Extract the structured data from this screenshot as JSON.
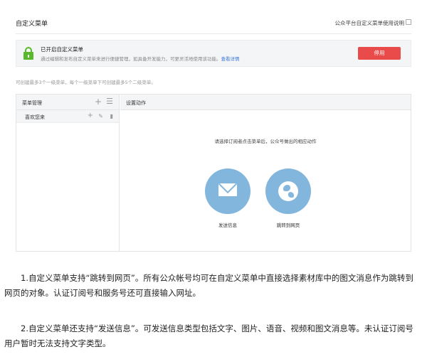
{
  "header": {
    "title": "自定义菜单",
    "help_link": "公众平台自定义菜单使用说明"
  },
  "notice": {
    "title": "已开启自定义菜单",
    "description": "通过编辑和发布自定义菜单来进行便捷管理，如具备开发能力，可更灵活地使用该功能。",
    "link": "查看详情",
    "stop_button": "停用"
  },
  "limit_note": "可创建最多3个一级菜单，每个一级菜单下可创建最多5个二级菜单。",
  "menu_panel": {
    "title": "菜单管理",
    "items": [
      {
        "label": "喜欢您来"
      }
    ]
  },
  "action_panel": {
    "title": "设置动作",
    "prompt": "请选择订阅者点击菜单后，公众号做出的相应动作",
    "options": [
      {
        "label": "发送信息",
        "icon": "mail-icon"
      },
      {
        "label": "跳转到网页",
        "icon": "globe-icon"
      }
    ]
  },
  "colors": {
    "accent_green": "#59b82b",
    "stop_red": "#e94a4a",
    "action_blue": "#83b6dd",
    "link_blue": "#3979d3"
  },
  "article": {
    "paragraphs": [
      "1.自定义菜单支持“跳转到网页”。所有公众帐号均可在自定义菜单中直接选择素材库中的图文消息作为跳转到网页的对象。认证订阅号和服务号还可直接输入网址。",
      "2.自定义菜单还支持“发送信息”。可发送信息类型包括文字、图片、语音、视频和图文消息等。未认证订阅号用户暂时无法支持文字类型。"
    ]
  }
}
